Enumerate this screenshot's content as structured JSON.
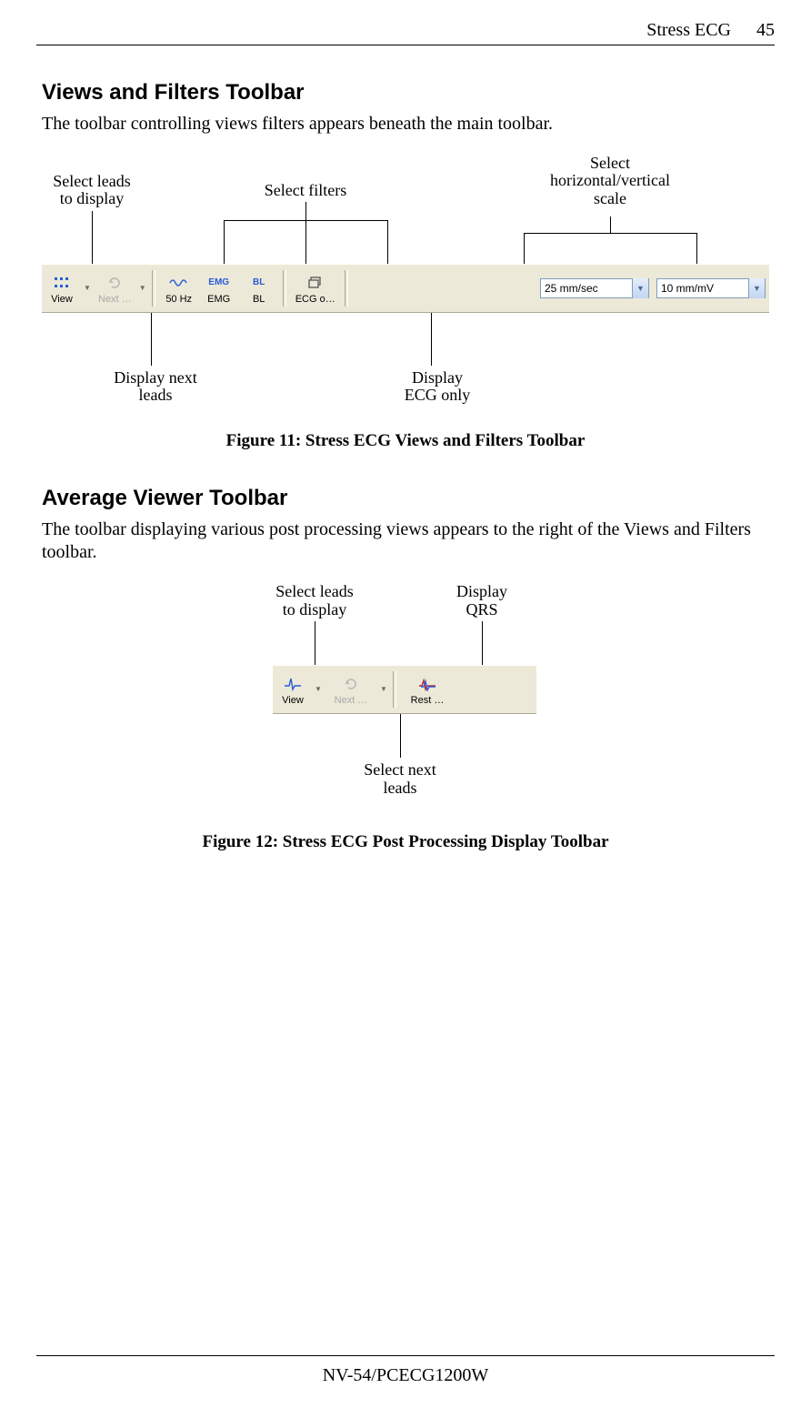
{
  "running_head": {
    "chapter": "Stress ECG",
    "page": "45"
  },
  "section1": {
    "title": "Views and Filters Toolbar",
    "body": "The toolbar controlling views filters appears beneath the main toolbar."
  },
  "fig11": {
    "caption": "Figure 11: Stress ECG Views and Filters Toolbar",
    "callouts": {
      "leads": "Select leads\nto display",
      "filters": "Select filters",
      "scale": "Select\nhorizontal/vertical\nscale",
      "next": "Display next\nleads",
      "ecgonly": "Display\nECG only"
    },
    "toolbar": {
      "view": "View",
      "next": "Next …",
      "hz": "50 Hz",
      "emg": "EMG",
      "bl": "BL",
      "ecgo": "ECG o…",
      "emg_icon": "EMG",
      "bl_icon": "BL",
      "speed": "25 mm/sec",
      "gain": "10 mm/mV"
    }
  },
  "section2": {
    "title": "Average Viewer Toolbar",
    "body": "The toolbar displaying various post processing views appears to the right of the Views and Filters toolbar."
  },
  "fig12": {
    "caption": "Figure 12: Stress ECG Post Processing Display Toolbar",
    "callouts": {
      "leads": "Select leads\nto display",
      "qrs": "Display\nQRS",
      "next": "Select next\nleads"
    },
    "toolbar": {
      "view": "View",
      "next": "Next …",
      "rest": "Rest …"
    }
  },
  "footer": "NV-54/PCECG1200W"
}
